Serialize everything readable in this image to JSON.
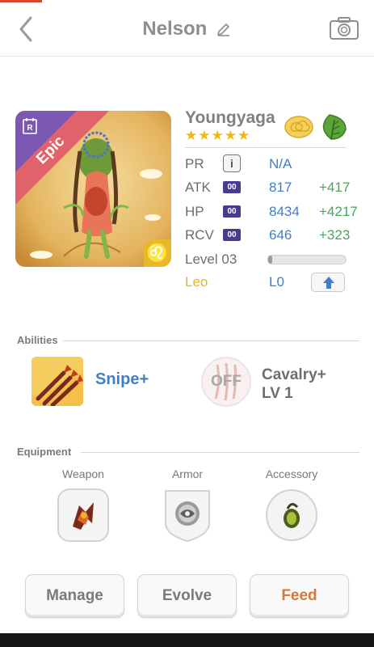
{
  "header": {
    "title": "Nelson"
  },
  "unit": {
    "name": "Youngyaga",
    "rarity": "Epic",
    "stars": "★★★★★",
    "star_count": 5,
    "zodiac_symbol": "♌",
    "rarity_letter": "R"
  },
  "stats": {
    "pr": {
      "label": "PR",
      "info": "i",
      "value": "N/A"
    },
    "atk": {
      "label": "ATK",
      "badge": "00",
      "value": "817",
      "bonus": "+417"
    },
    "hp": {
      "label": "HP",
      "badge": "00",
      "value": "8434",
      "bonus": "+4217"
    },
    "rcv": {
      "label": "RCV",
      "badge": "00",
      "value": "646",
      "bonus": "+323"
    },
    "level": {
      "label": "Level 03",
      "progress": 0.05
    },
    "zodiac": {
      "label": "Leo",
      "value": "L0"
    }
  },
  "abilities": {
    "section_label": "Abilities",
    "active": {
      "name": "Snipe+"
    },
    "passive": {
      "state": "OFF",
      "name_line1": "Cavalry+",
      "name_line2": "LV 1"
    }
  },
  "equipment": {
    "section_label": "Equipment",
    "weapon": "Weapon",
    "armor": "Armor",
    "accessory": "Accessory"
  },
  "actions": {
    "manage": "Manage",
    "evolve": "Evolve",
    "feed": "Feed"
  },
  "colors": {
    "accent_blue": "#3f7fc7",
    "bonus_green": "#46a65b",
    "star_gold": "#f3b712",
    "feed_orange": "#d3783a",
    "epic_red": "#e0626b",
    "badge_purple": "#4a3b8c"
  }
}
